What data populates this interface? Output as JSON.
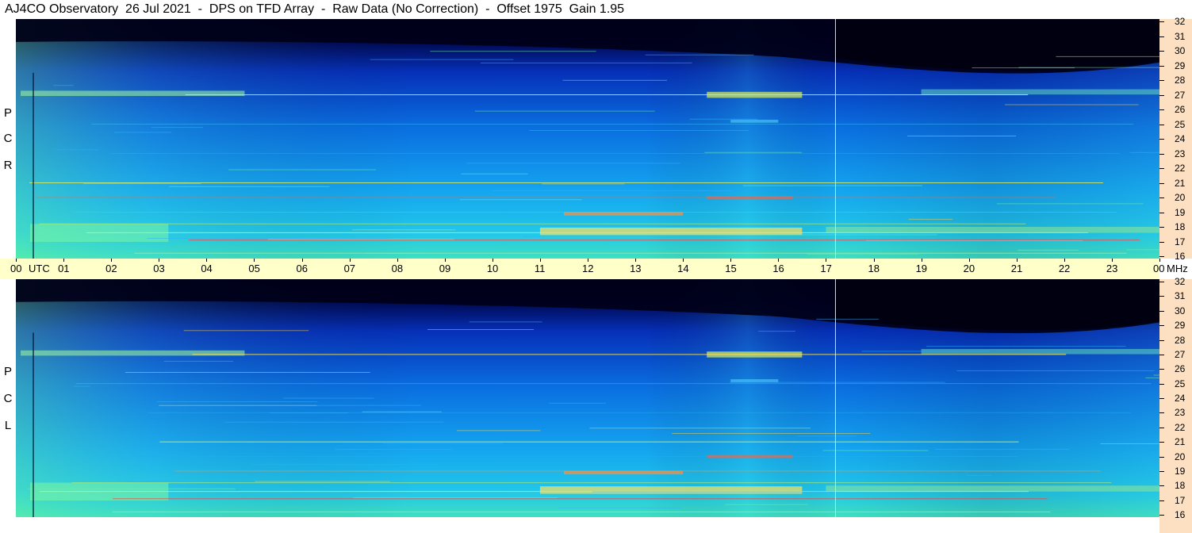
{
  "header": {
    "title": "AJ4CO Observatory  26 Jul 2021  -  DPS on TFD Array  -  Raw Data (No Correction)  -  Offset 1975  Gain 1.95"
  },
  "panels": [
    {
      "id": "rcp",
      "label_letters": [
        "P",
        "C",
        "R"
      ]
    },
    {
      "id": "lcp",
      "label_letters": [
        "P",
        "C",
        "L"
      ]
    }
  ],
  "chart_data": {
    "type": "heatmap",
    "x_axis": {
      "unit_label": "UTC",
      "ticks": [
        "00",
        "01",
        "02",
        "03",
        "04",
        "05",
        "06",
        "07",
        "08",
        "09",
        "10",
        "11",
        "12",
        "13",
        "14",
        "15",
        "16",
        "17",
        "18",
        "19",
        "20",
        "21",
        "22",
        "23",
        "00"
      ],
      "range_hours": [
        0,
        24
      ]
    },
    "y_axis": {
      "unit_label": "MHz",
      "ticks": [
        "32",
        "31",
        "30",
        "29",
        "28",
        "27",
        "26",
        "25",
        "24",
        "23",
        "22",
        "21",
        "20",
        "19",
        "18",
        "17",
        "16"
      ],
      "range_mhz": [
        16,
        32
      ]
    },
    "marker_line_utc_hours": 17.2,
    "colors": {
      "background_quiet": "#000020",
      "low": "#0a3acc",
      "mid": "#14a6f0",
      "high": "#6ff0a0",
      "peak": "#ff3030",
      "marker": "#e8f060"
    }
  }
}
